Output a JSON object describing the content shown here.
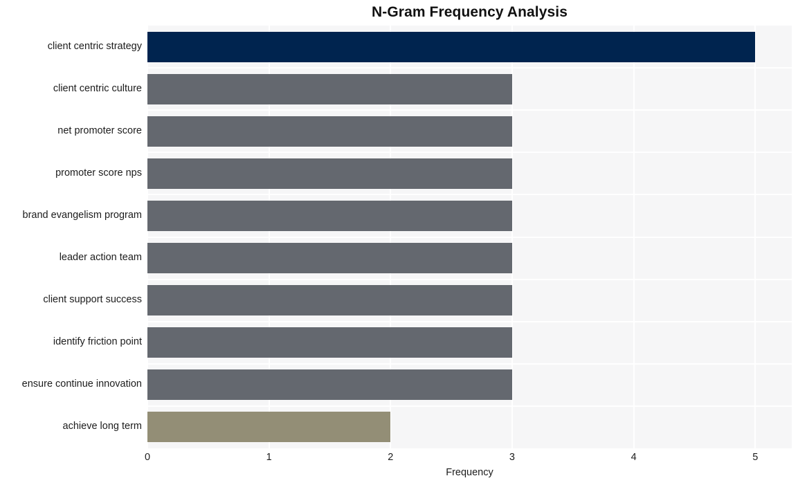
{
  "chart_data": {
    "type": "bar",
    "orientation": "horizontal",
    "title": "N-Gram Frequency Analysis",
    "xlabel": "Frequency",
    "ylabel": "",
    "xlim": [
      0,
      5.3
    ],
    "xticks": [
      "0",
      "1",
      "2",
      "3",
      "4",
      "5"
    ],
    "xtick_values": [
      0,
      1,
      2,
      3,
      4,
      5
    ],
    "grid": true,
    "legend": false,
    "categories": [
      "client centric strategy",
      "client centric culture",
      "net promoter score",
      "promoter score nps",
      "brand evangelism program",
      "leader action team",
      "client support success",
      "identify friction point",
      "ensure continue innovation",
      "achieve long term"
    ],
    "values": [
      5,
      3,
      3,
      3,
      3,
      3,
      3,
      3,
      3,
      2
    ],
    "bar_colors": [
      "#00244f",
      "#64686f",
      "#64686f",
      "#64686f",
      "#64686f",
      "#64686f",
      "#64686f",
      "#64686f",
      "#64686f",
      "#938e76"
    ],
    "plot_background": "#f6f6f7",
    "gridline_color": "#ffffff",
    "page_background": "#ffffff",
    "text_color": "#1c1c1c"
  }
}
